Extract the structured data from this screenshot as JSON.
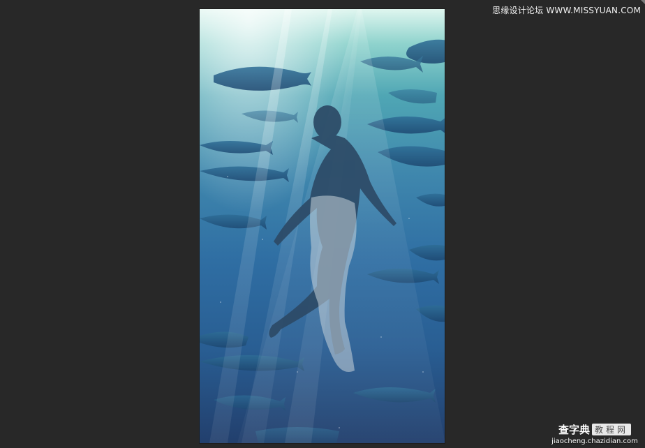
{
  "workspace": {
    "background": "#282828"
  },
  "artwork": {
    "subject": "underwater scene with swimming figure, school of tuna and light rays",
    "colors": {
      "top": "#dff6ef",
      "mid": "#3f87ad",
      "bottom": "#223f6d",
      "fish": "#24557f",
      "figure": "#2c4a66"
    }
  },
  "watermarks": {
    "top_right": "思缘设计论坛 WWW.MISSYUAN.COM",
    "bottom_main": "查字典",
    "bottom_tag": "教程网",
    "bottom_url": "jiaocheng.chazidian.com"
  }
}
